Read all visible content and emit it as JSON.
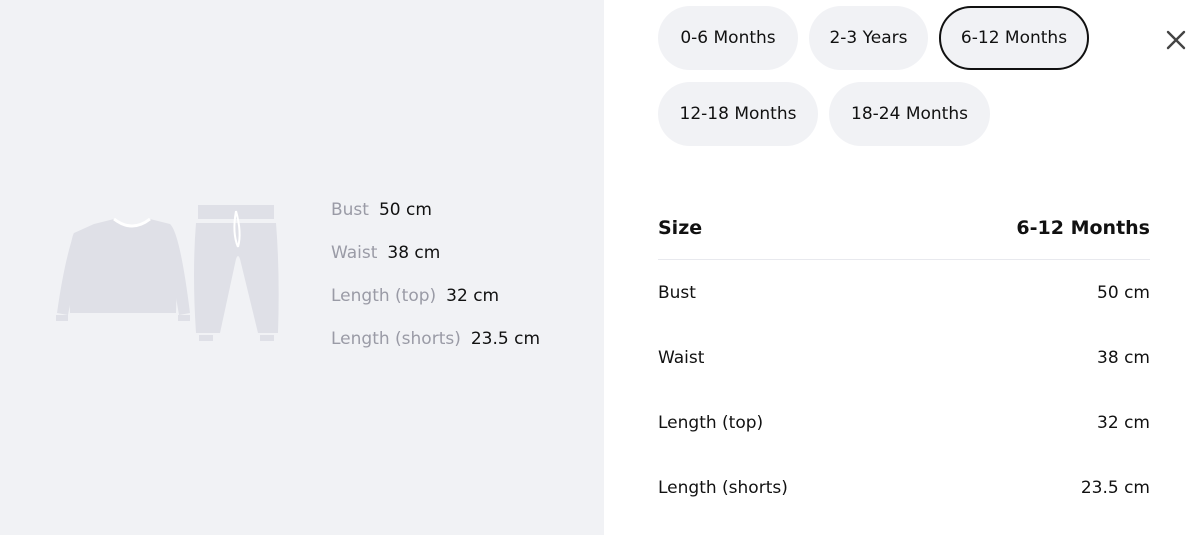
{
  "summary": {
    "rows": [
      {
        "label": "Bust",
        "value": "50 cm"
      },
      {
        "label": "Waist",
        "value": "38 cm"
      },
      {
        "label": "Length (top)",
        "value": "32 cm"
      },
      {
        "label": "Length (shorts)",
        "value": "23.5 cm"
      }
    ]
  },
  "size_options": [
    {
      "label": "0-6 Months",
      "selected": false
    },
    {
      "label": "2-3 Years",
      "selected": false
    },
    {
      "label": "6-12 Months",
      "selected": true
    },
    {
      "label": "12-18 Months",
      "selected": false
    },
    {
      "label": "18-24 Months",
      "selected": false
    }
  ],
  "table": {
    "header_label": "Size",
    "header_value": "6-12 Months",
    "rows": [
      {
        "label": "Bust",
        "value": "50 cm"
      },
      {
        "label": "Waist",
        "value": "38 cm"
      },
      {
        "label": "Length (top)",
        "value": "32 cm"
      },
      {
        "label": "Length (shorts)",
        "value": "23.5 cm"
      }
    ]
  },
  "icons": {
    "close": "close-icon",
    "sweater": "sweater-icon",
    "pants": "pants-icon"
  },
  "colors": {
    "panel_bg": "#f1f2f5",
    "garment_fill": "#dfe0e7",
    "muted_text": "#9a9ba6",
    "selected_border": "#111111"
  }
}
